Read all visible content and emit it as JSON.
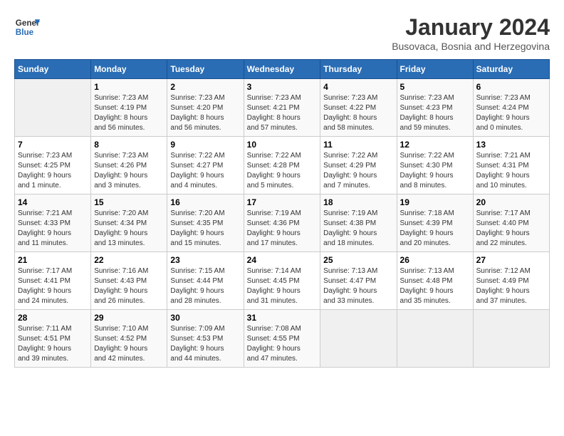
{
  "logo": {
    "line1": "General",
    "line2": "Blue"
  },
  "title": "January 2024",
  "subtitle": "Busovaca, Bosnia and Herzegovina",
  "days_of_week": [
    "Sunday",
    "Monday",
    "Tuesday",
    "Wednesday",
    "Thursday",
    "Friday",
    "Saturday"
  ],
  "weeks": [
    [
      {
        "day": "",
        "info": ""
      },
      {
        "day": "1",
        "info": "Sunrise: 7:23 AM\nSunset: 4:19 PM\nDaylight: 8 hours\nand 56 minutes."
      },
      {
        "day": "2",
        "info": "Sunrise: 7:23 AM\nSunset: 4:20 PM\nDaylight: 8 hours\nand 56 minutes."
      },
      {
        "day": "3",
        "info": "Sunrise: 7:23 AM\nSunset: 4:21 PM\nDaylight: 8 hours\nand 57 minutes."
      },
      {
        "day": "4",
        "info": "Sunrise: 7:23 AM\nSunset: 4:22 PM\nDaylight: 8 hours\nand 58 minutes."
      },
      {
        "day": "5",
        "info": "Sunrise: 7:23 AM\nSunset: 4:23 PM\nDaylight: 8 hours\nand 59 minutes."
      },
      {
        "day": "6",
        "info": "Sunrise: 7:23 AM\nSunset: 4:24 PM\nDaylight: 9 hours\nand 0 minutes."
      }
    ],
    [
      {
        "day": "7",
        "info": "Sunrise: 7:23 AM\nSunset: 4:25 PM\nDaylight: 9 hours\nand 1 minute."
      },
      {
        "day": "8",
        "info": "Sunrise: 7:23 AM\nSunset: 4:26 PM\nDaylight: 9 hours\nand 3 minutes."
      },
      {
        "day": "9",
        "info": "Sunrise: 7:22 AM\nSunset: 4:27 PM\nDaylight: 9 hours\nand 4 minutes."
      },
      {
        "day": "10",
        "info": "Sunrise: 7:22 AM\nSunset: 4:28 PM\nDaylight: 9 hours\nand 5 minutes."
      },
      {
        "day": "11",
        "info": "Sunrise: 7:22 AM\nSunset: 4:29 PM\nDaylight: 9 hours\nand 7 minutes."
      },
      {
        "day": "12",
        "info": "Sunrise: 7:22 AM\nSunset: 4:30 PM\nDaylight: 9 hours\nand 8 minutes."
      },
      {
        "day": "13",
        "info": "Sunrise: 7:21 AM\nSunset: 4:31 PM\nDaylight: 9 hours\nand 10 minutes."
      }
    ],
    [
      {
        "day": "14",
        "info": "Sunrise: 7:21 AM\nSunset: 4:33 PM\nDaylight: 9 hours\nand 11 minutes."
      },
      {
        "day": "15",
        "info": "Sunrise: 7:20 AM\nSunset: 4:34 PM\nDaylight: 9 hours\nand 13 minutes."
      },
      {
        "day": "16",
        "info": "Sunrise: 7:20 AM\nSunset: 4:35 PM\nDaylight: 9 hours\nand 15 minutes."
      },
      {
        "day": "17",
        "info": "Sunrise: 7:19 AM\nSunset: 4:36 PM\nDaylight: 9 hours\nand 17 minutes."
      },
      {
        "day": "18",
        "info": "Sunrise: 7:19 AM\nSunset: 4:38 PM\nDaylight: 9 hours\nand 18 minutes."
      },
      {
        "day": "19",
        "info": "Sunrise: 7:18 AM\nSunset: 4:39 PM\nDaylight: 9 hours\nand 20 minutes."
      },
      {
        "day": "20",
        "info": "Sunrise: 7:17 AM\nSunset: 4:40 PM\nDaylight: 9 hours\nand 22 minutes."
      }
    ],
    [
      {
        "day": "21",
        "info": "Sunrise: 7:17 AM\nSunset: 4:41 PM\nDaylight: 9 hours\nand 24 minutes."
      },
      {
        "day": "22",
        "info": "Sunrise: 7:16 AM\nSunset: 4:43 PM\nDaylight: 9 hours\nand 26 minutes."
      },
      {
        "day": "23",
        "info": "Sunrise: 7:15 AM\nSunset: 4:44 PM\nDaylight: 9 hours\nand 28 minutes."
      },
      {
        "day": "24",
        "info": "Sunrise: 7:14 AM\nSunset: 4:45 PM\nDaylight: 9 hours\nand 31 minutes."
      },
      {
        "day": "25",
        "info": "Sunrise: 7:13 AM\nSunset: 4:47 PM\nDaylight: 9 hours\nand 33 minutes."
      },
      {
        "day": "26",
        "info": "Sunrise: 7:13 AM\nSunset: 4:48 PM\nDaylight: 9 hours\nand 35 minutes."
      },
      {
        "day": "27",
        "info": "Sunrise: 7:12 AM\nSunset: 4:49 PM\nDaylight: 9 hours\nand 37 minutes."
      }
    ],
    [
      {
        "day": "28",
        "info": "Sunrise: 7:11 AM\nSunset: 4:51 PM\nDaylight: 9 hours\nand 39 minutes."
      },
      {
        "day": "29",
        "info": "Sunrise: 7:10 AM\nSunset: 4:52 PM\nDaylight: 9 hours\nand 42 minutes."
      },
      {
        "day": "30",
        "info": "Sunrise: 7:09 AM\nSunset: 4:53 PM\nDaylight: 9 hours\nand 44 minutes."
      },
      {
        "day": "31",
        "info": "Sunrise: 7:08 AM\nSunset: 4:55 PM\nDaylight: 9 hours\nand 47 minutes."
      },
      {
        "day": "",
        "info": ""
      },
      {
        "day": "",
        "info": ""
      },
      {
        "day": "",
        "info": ""
      }
    ]
  ]
}
